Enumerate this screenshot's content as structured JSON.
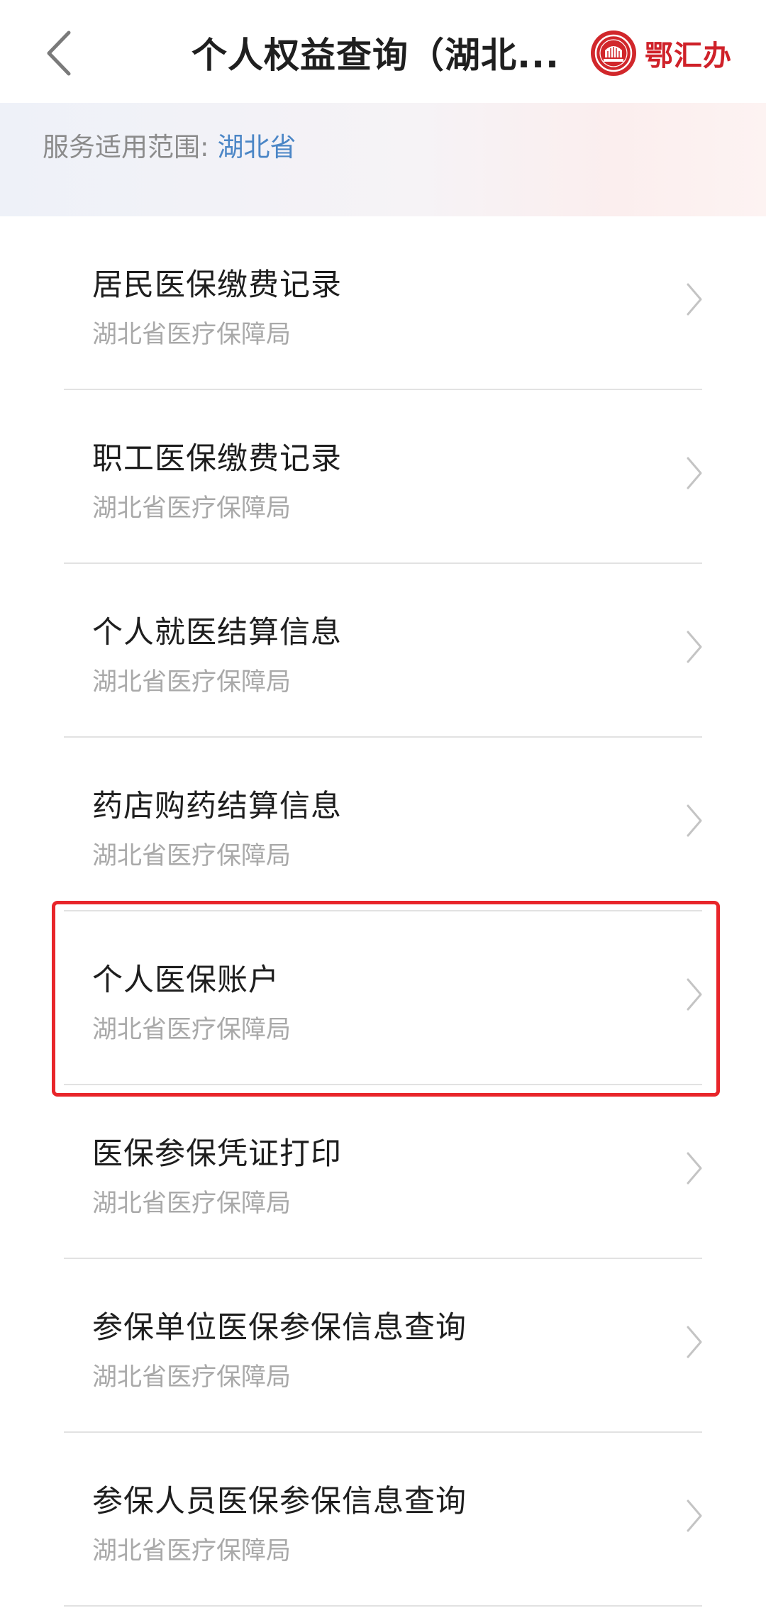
{
  "header": {
    "title": "个人权益查询（湖北...",
    "back_icon": "chevron-left-icon",
    "logo_text": "鄂汇办",
    "logo_icon": "ehuiban-seal-logo",
    "brand_color": "#cf2129"
  },
  "scope": {
    "label": "服务适用范围:",
    "value": "湖北省",
    "value_color": "#4b86c6"
  },
  "services": [
    {
      "title": "居民医保缴费记录",
      "provider": "湖北省医疗保障局"
    },
    {
      "title": "职工医保缴费记录",
      "provider": "湖北省医疗保障局"
    },
    {
      "title": "个人就医结算信息",
      "provider": "湖北省医疗保障局"
    },
    {
      "title": "药店购药结算信息",
      "provider": "湖北省医疗保障局"
    },
    {
      "title": "个人医保账户",
      "provider": "湖北省医疗保障局",
      "highlighted": true
    },
    {
      "title": "医保参保凭证打印",
      "provider": "湖北省医疗保障局"
    },
    {
      "title": "参保单位医保参保信息查询",
      "provider": "湖北省医疗保障局"
    },
    {
      "title": "参保人员医保参保信息查询",
      "provider": "湖北省医疗保障局"
    }
  ],
  "highlight_color": "#e8252a"
}
